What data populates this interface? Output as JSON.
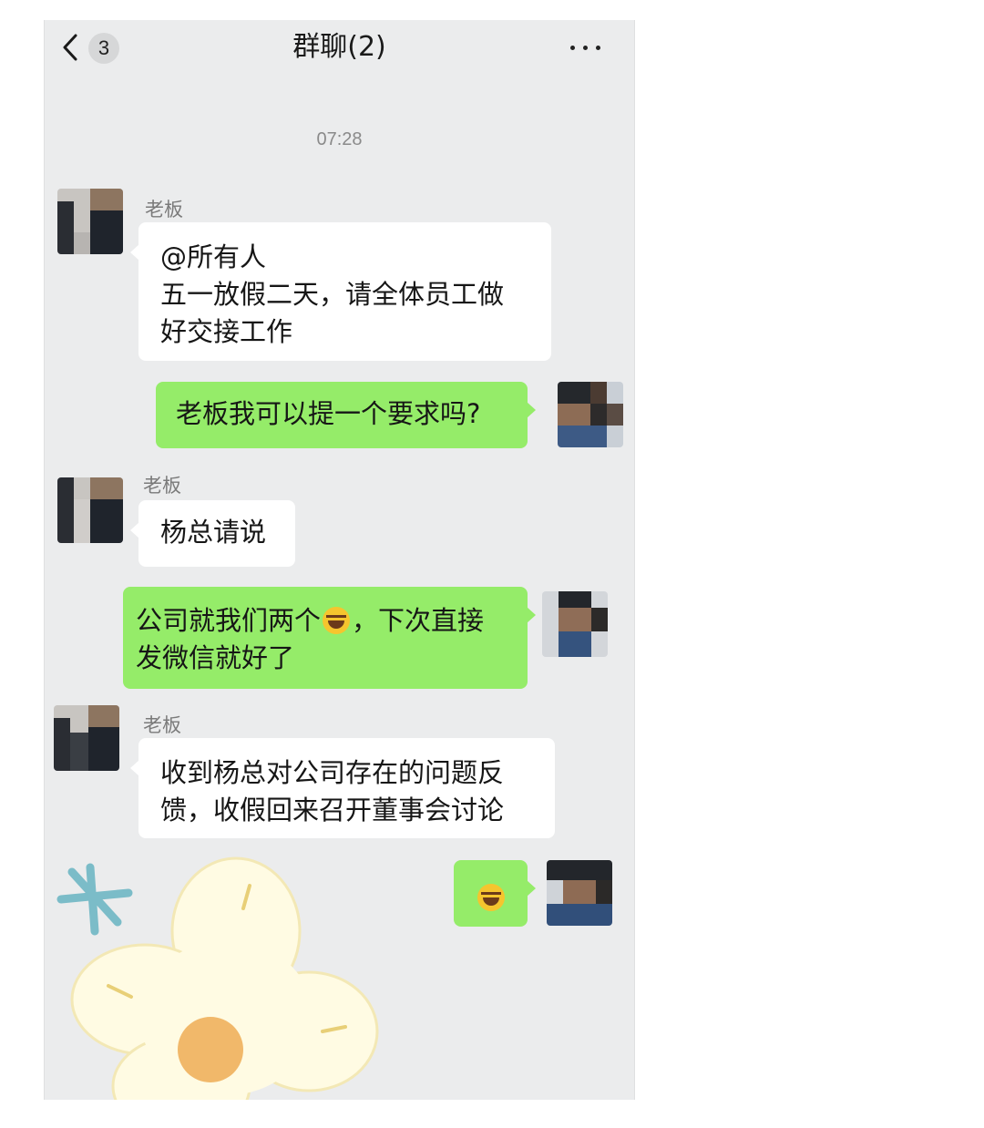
{
  "header": {
    "back_count": "3",
    "title": "群聊(2)"
  },
  "timestamp": "07:28",
  "messages": [
    {
      "side": "left",
      "sender": "老板",
      "text": "@所有人\n五一放假二天，请全体员工做\n好交接工作"
    },
    {
      "side": "right",
      "text": "老板我可以提一个要求吗?"
    },
    {
      "side": "left",
      "sender": "老板",
      "text": "杨总请说"
    },
    {
      "side": "right",
      "text_before_emoji": "公司就我们两个",
      "emoji": "laugh-cry-emoji",
      "text_after_emoji": "，下次直接\n发微信就好了"
    },
    {
      "side": "left",
      "sender": "老板",
      "text": "收到杨总对公司存在的问题反\n馈，收假回来召开董事会讨论"
    },
    {
      "side": "right",
      "emoji": "laugh-cry-emoji"
    }
  ],
  "colors": {
    "chat_background": "#ebeced",
    "left_bubble": "#ffffff",
    "right_bubble": "#95ec69",
    "sender_name": "#7a7a7a",
    "timestamp": "#8a8a8a"
  },
  "icons": {
    "back": "chevron-left-icon",
    "more": "more-dots-icon",
    "sticker": "flower-sticker"
  }
}
